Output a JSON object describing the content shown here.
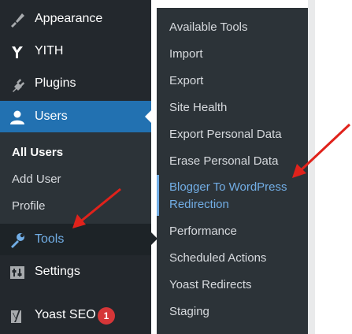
{
  "sidebar": {
    "items": [
      {
        "label": "Appearance",
        "icon": "paintbrush-icon"
      },
      {
        "label": "YITH",
        "icon": "yith-logo-icon"
      },
      {
        "label": "Plugins",
        "icon": "plug-icon"
      },
      {
        "label": "Users",
        "icon": "user-icon"
      },
      {
        "label": "Tools",
        "icon": "wrench-icon"
      },
      {
        "label": "Settings",
        "icon": "sliders-icon"
      },
      {
        "label": "Yoast SEO",
        "icon": "yoast-logo-icon",
        "badge": "1"
      }
    ],
    "users_submenu": [
      "All Users",
      "Add User",
      "Profile"
    ]
  },
  "flyout": {
    "items": [
      "Available Tools",
      "Import",
      "Export",
      "Site Health",
      "Export Personal Data",
      "Erase Personal Data",
      "Blogger To WordPress",
      "Redirection",
      "Performance",
      "Scheduled Actions",
      "Yoast Redirects",
      "Staging"
    ]
  },
  "colors": {
    "sidebar_bg": "#23282d",
    "active_bg": "#2271b1",
    "highlight_text": "#72aee6",
    "annotation_arrow": "#e0221b"
  }
}
